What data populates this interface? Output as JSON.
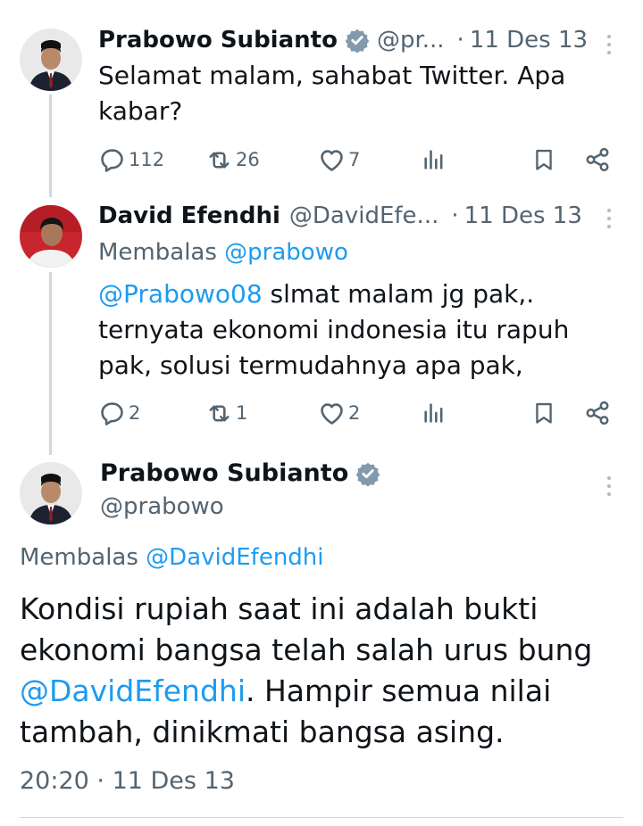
{
  "tweet1": {
    "name": "Prabowo Subianto",
    "handle": "@pr...",
    "date": "11 Des 13",
    "text": "Selamat malam, sahabat Twitter. Apa kabar?",
    "replies": "112",
    "retweets": "26",
    "likes": "7"
  },
  "tweet2": {
    "name": "David Efendhi",
    "handle": "@DavidEfe...",
    "date": "11 Des 13",
    "replying_label": "Membalas",
    "replying_to": "@prabowo",
    "mention": "@Prabowo08",
    "text": " slmat malam jg pak,. ternyata ekonomi indonesia itu rapuh pak, solusi termudahnya apa pak,",
    "replies": "2",
    "retweets": "1",
    "likes": "2"
  },
  "main_tweet": {
    "name": "Prabowo Subianto",
    "handle": "@prabowo",
    "replying_label": "Membalas",
    "replying_to": "@DavidEfendhi",
    "text_part1": "Kondisi rupiah saat ini adalah bukti ekonomi bangsa telah salah urus bung ",
    "mention": "@DavidEfendhi",
    "text_part2": ". Hampir semua nilai tambah, dinikmati bangsa asing.",
    "time": "20:20",
    "date": "11 Des 13"
  },
  "colors": {
    "link": "#1d9bf0",
    "muted": "#536471",
    "verified": "#829aab",
    "thread_line": "#cfd9de"
  },
  "icons": [
    "reply-icon",
    "retweet-icon",
    "like-icon",
    "views-icon",
    "bookmark-icon",
    "share-icon",
    "more-icon",
    "verified-badge-icon"
  ]
}
